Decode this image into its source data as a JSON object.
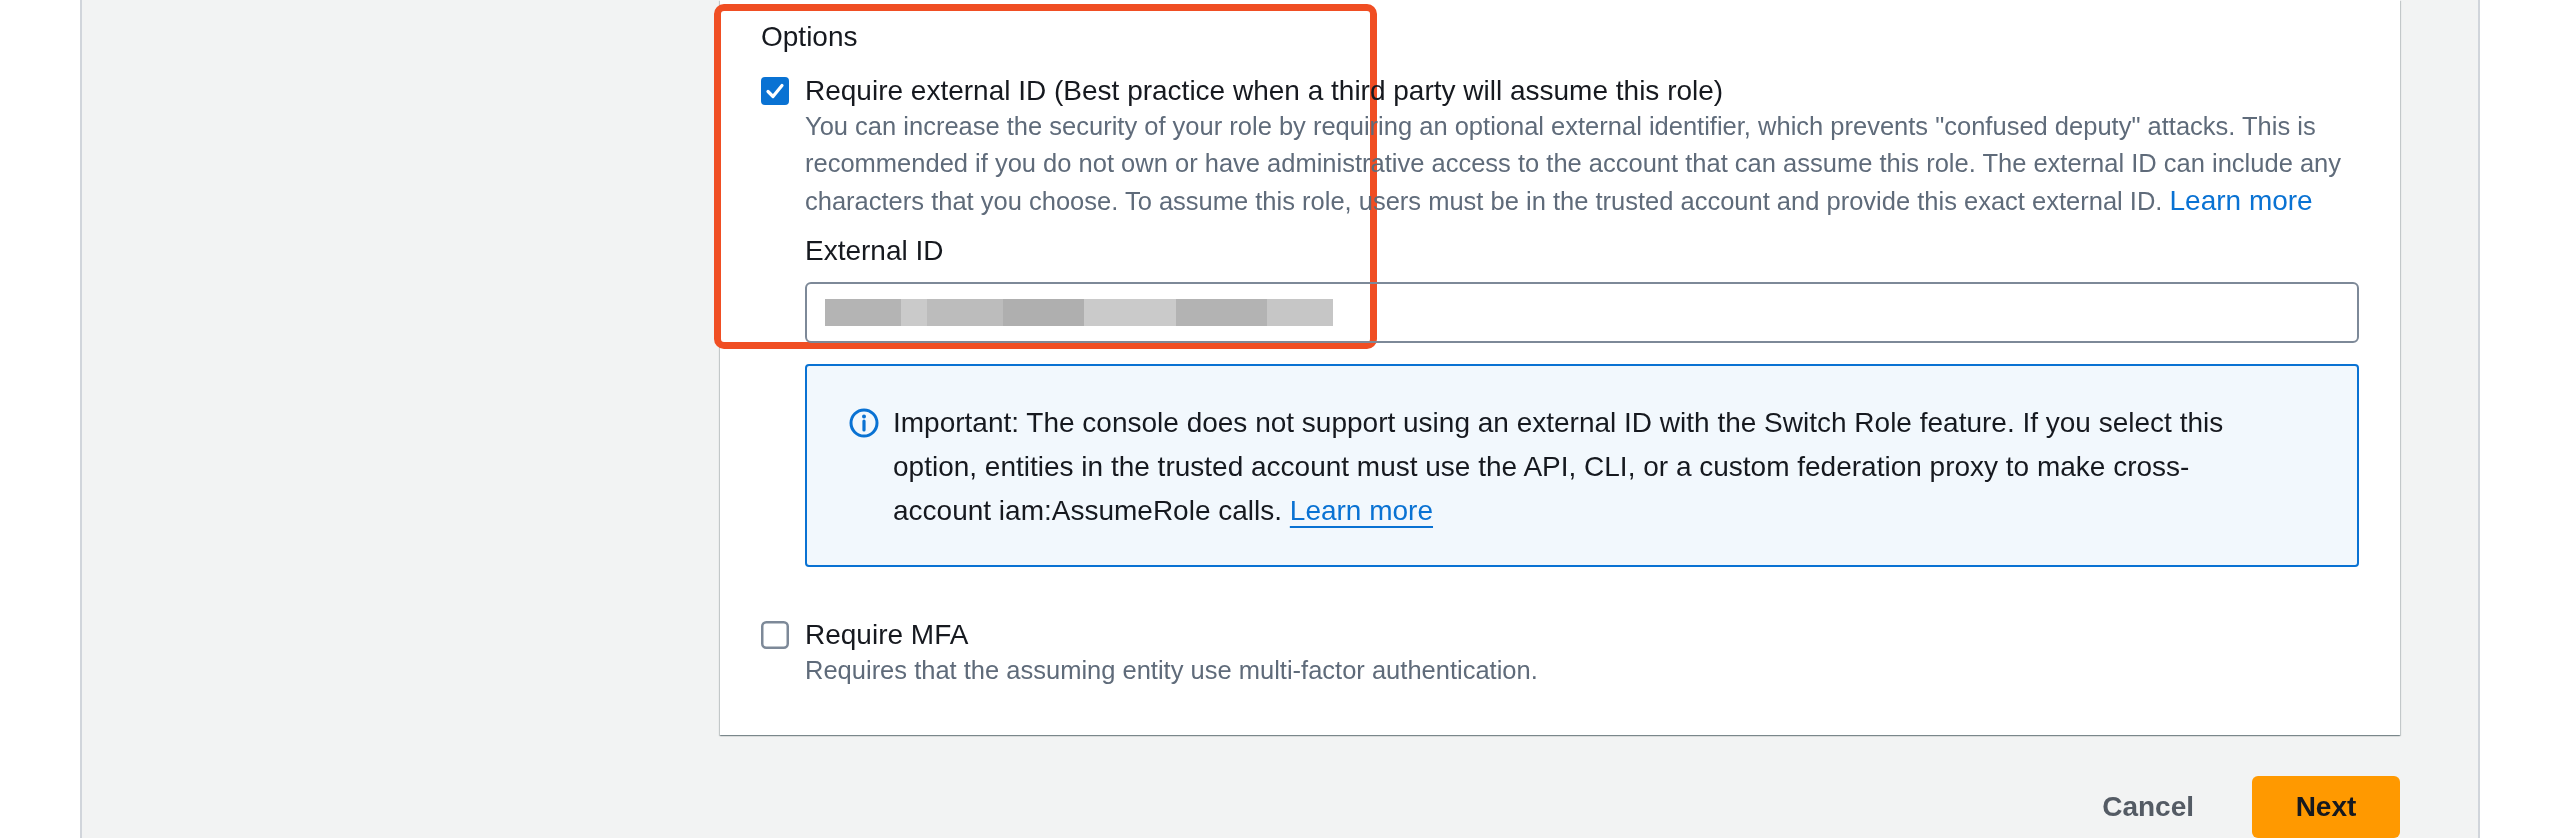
{
  "options": {
    "title": "Options",
    "items": [
      {
        "label": "Require external ID (Best practice when a third party will assume this role)",
        "checked": true,
        "description": "You can increase the security of your role by requiring an optional external identifier, which prevents \"confused deputy\" attacks. This is recommended if you do not own or have administrative access to the account that can assume this role. The external ID can include any characters that you choose. To assume this role, users must be in the trusted account and provide this exact external ID.",
        "link": "Learn more",
        "field": {
          "label": "External ID",
          "redacted": true
        },
        "alert": {
          "kind": "info",
          "text": "Important: The console does not support using an external ID with the Switch Role feature. If you select this option, entities in the trusted account must use the API, CLI, or a custom federation proxy to make cross-account iam:AssumeRole calls.",
          "link": "Learn more"
        }
      },
      {
        "label": "Require MFA",
        "checked": false,
        "description": "Requires that the assuming entity use multi-factor authentication."
      }
    ]
  },
  "actions": [
    {
      "label": "Cancel",
      "kind": "normal"
    },
    {
      "label": "Next",
      "kind": "primary"
    }
  ]
}
